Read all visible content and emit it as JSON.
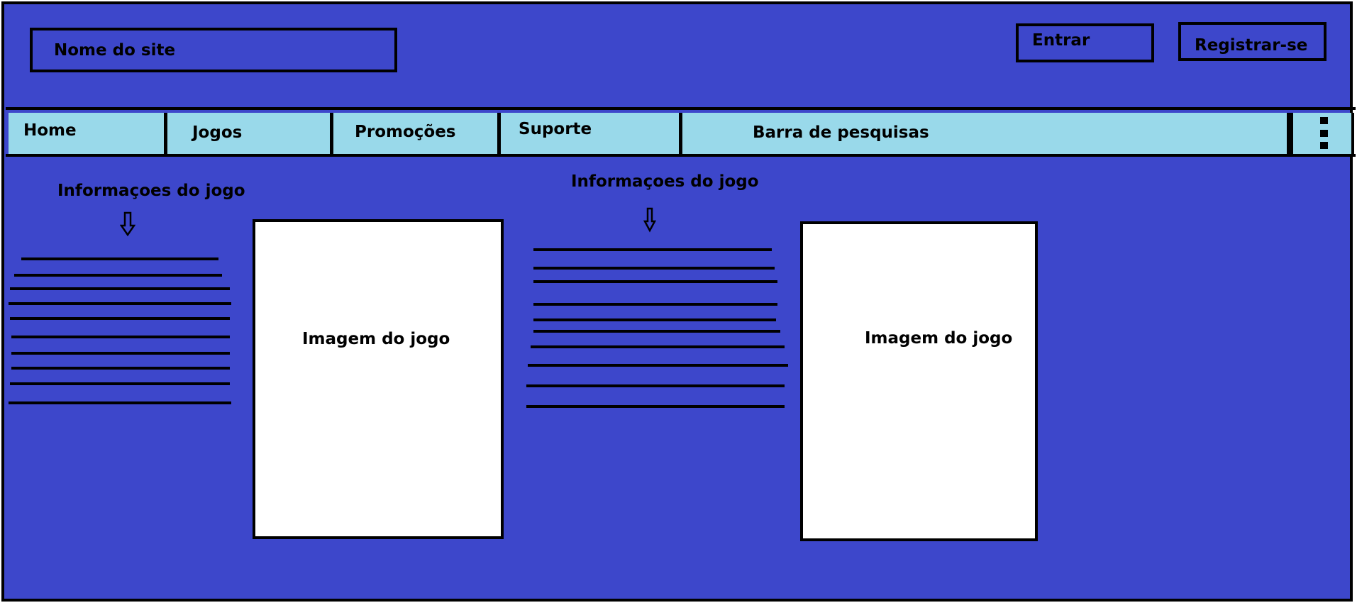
{
  "header": {
    "site_name": "Nome do site",
    "login_label": "Entrar",
    "register_label": "Registrar-se"
  },
  "nav": {
    "items": [
      {
        "label": "Home"
      },
      {
        "label": "Jogos"
      },
      {
        "label": "Promoções"
      },
      {
        "label": "Suporte"
      }
    ],
    "search_label": "Barra de pesquisas",
    "menu_icon": "kebab-menu-icon"
  },
  "games": [
    {
      "info_label": "Informaçoes do jogo",
      "image_label": "Imagem do jogo"
    },
    {
      "info_label": "Informaçoes do jogo",
      "image_label": "Imagem do jogo"
    }
  ],
  "colors": {
    "background": "#3d47cb",
    "nav_background": "#99d9ea",
    "image_background": "#ffffff",
    "outline": "#000000"
  }
}
